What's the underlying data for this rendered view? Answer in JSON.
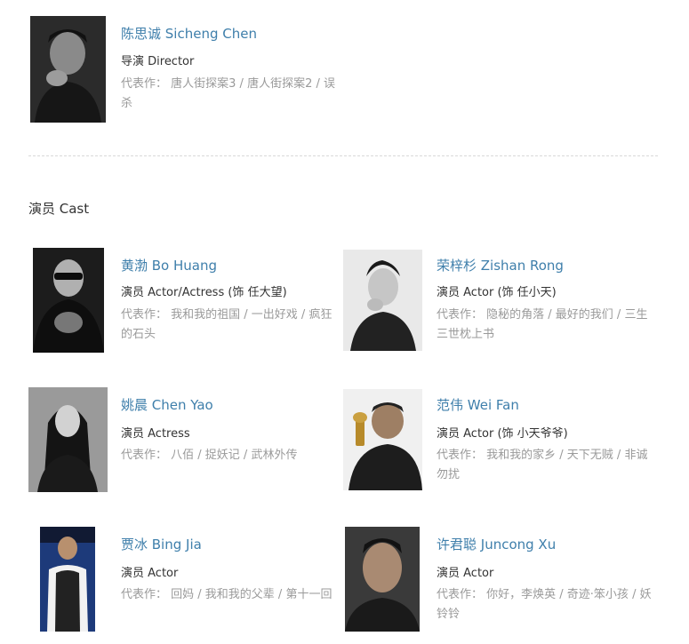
{
  "director": {
    "name": "陈思诚 Sicheng Chen",
    "role": "导演 Director",
    "works_label": "代表作：",
    "works": "唐人街探案3 / 唐人街探案2 / 误杀"
  },
  "cast_section": {
    "title": "演员 Cast",
    "works_label": "代表作："
  },
  "cast": [
    {
      "name": "黄渤 Bo Huang",
      "role": "演员 Actor/Actress (饰 任大望)",
      "works": "我和我的祖国 / 一出好戏 / 疯狂的石头"
    },
    {
      "name": "荣梓杉 Zishan Rong",
      "role": "演员 Actor (饰 任小天)",
      "works": "隐秘的角落 / 最好的我们 / 三生三世枕上书"
    },
    {
      "name": "姚晨 Chen Yao",
      "role": "演员 Actress",
      "works": "八佰 / 捉妖记 / 武林外传"
    },
    {
      "name": "范伟 Wei Fan",
      "role": "演员 Actor (饰 小天爷爷)",
      "works": "我和我的家乡 / 天下无贼 / 非诚勿扰"
    },
    {
      "name": "贾冰 Bing Jia",
      "role": "演员 Actor",
      "works": "回妈 / 我和我的父辈 / 第十一回"
    },
    {
      "name": "许君聪 Juncong Xu",
      "role": "演员 Actor",
      "works": "你好，李焕英 / 奇迹·笨小孩 / 妖铃铃"
    }
  ],
  "colors": {
    "name_link": "#3f7fab",
    "secondary_text": "#9a9a9a",
    "divider": "#d9d9d9"
  }
}
